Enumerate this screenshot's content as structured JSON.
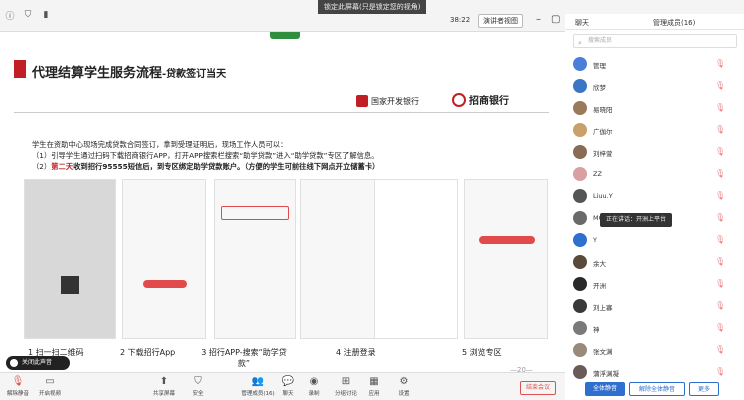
{
  "topbar": {
    "banner": "锁定此屏幕(只是锁定您的视角)",
    "time": "38:22",
    "view_mode": "演讲者视图"
  },
  "sidebar": {
    "tabs": [
      "聊天",
      "管理成员(16)"
    ],
    "search_placeholder": "搜索成员",
    "participants": [
      {
        "name": "管理",
        "avatar_color": "#4a7fd8"
      },
      {
        "name": "欣梦",
        "avatar_color": "#3a76c4"
      },
      {
        "name": "易晓阳",
        "avatar_color": "#9a7a5a"
      },
      {
        "name": "广伽尔",
        "avatar_color": "#c9a06a"
      },
      {
        "name": "刘梓萱",
        "avatar_color": "#8a6b55"
      },
      {
        "name": "ZZ",
        "avatar_color": "#d8a0a0"
      },
      {
        "name": "Liuu.Y",
        "avatar_color": "#555555"
      },
      {
        "name": "MO",
        "avatar_color": "#6a6a6a"
      },
      {
        "name": "Y",
        "avatar_color": "#2f6fd0"
      },
      {
        "name": "余大",
        "avatar_color": "#5a4a3a"
      },
      {
        "name": "开洲",
        "avatar_color": "#2a2a2a"
      },
      {
        "name": "刘上寡",
        "avatar_color": "#3a3a3a"
      },
      {
        "name": "神",
        "avatar_color": "#7a7a7a"
      },
      {
        "name": "张文渊",
        "avatar_color": "#9a8a7a"
      },
      {
        "name": "蒲浮渊凝",
        "avatar_color": "#6a5a5a"
      }
    ],
    "btn_mute_all": "全体静音",
    "btn_unmute_all": "解除全体静音",
    "btn_more": "更多"
  },
  "slide": {
    "title": "代理结算学生服务流程",
    "title_sub": "-贷款签订当天",
    "bank1": "国家开发银行",
    "bank2": "招商银行",
    "para1": "学生在资助中心现场完成贷款合同签订，拿到受理证明后，现场工作人员可以：",
    "para2": "（1）引导学生通过扫码下载招商银行APP，打开APP搜索栏搜索“助学贷款”进入“助学贷款”专区了解信息。",
    "para3_a": "（2）",
    "para3_red": "第二天",
    "para3_b": "收到招行95555短信后，到专区绑定助学贷款账户。（方便的学生可前往线下网点开立储蓄卡）",
    "captions": [
      "1 扫一扫二维码",
      "2 下载招行App",
      "3 招行APP-搜索“助学贷款”",
      "4 注册登录",
      "5 浏览专区"
    ],
    "page_num": "—20—",
    "hint": "关闭此声音",
    "overlay_name": "正在讲话：开洲上平台"
  },
  "bottombar": {
    "items": [
      "解除静音",
      "开启视频",
      "共享屏幕",
      "安全",
      "管理成员(16)",
      "聊天",
      "录制",
      "分组讨论",
      "应用",
      "设置"
    ],
    "end": "结束会议"
  }
}
